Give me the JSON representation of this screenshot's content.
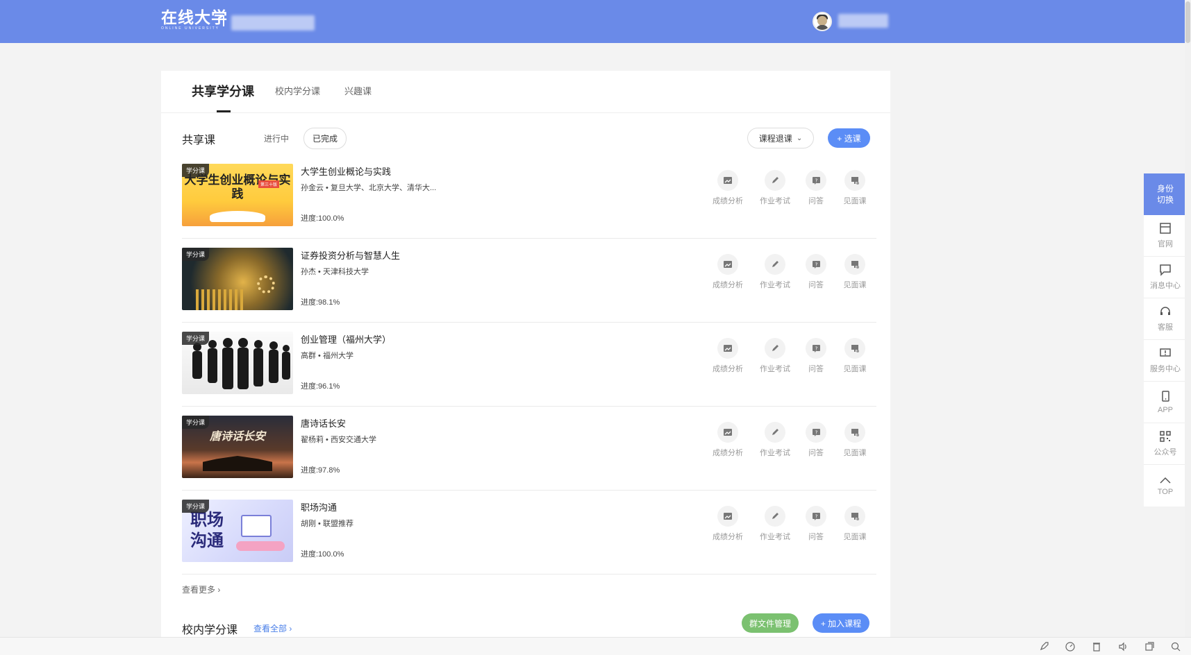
{
  "header": {
    "logo_text": "在线大学",
    "logo_sub": "ONLINE UNIVERSITY"
  },
  "tabs": [
    {
      "label": "共享学分课",
      "active": true
    },
    {
      "label": "校内学分课",
      "active": false
    },
    {
      "label": "兴趣课",
      "active": false
    }
  ],
  "shared": {
    "title": "共享课",
    "filter_ongoing": "进行中",
    "filter_done": "已完成",
    "dropdown_label": "课程退课",
    "select_button": "+ 选课",
    "badge": "学分课",
    "courses": [
      {
        "title": "大学生创业概论与实践",
        "teacher": "孙金云 • 复旦大学、北京大学、清华大...",
        "progress": "进度:100.0%",
        "thumb_text": "大学生创业概论与实践",
        "thumb_tag": "第三十版"
      },
      {
        "title": "证券投资分析与智慧人生",
        "teacher": "孙杰 • 天津科技大学",
        "progress": "进度:98.1%"
      },
      {
        "title": "创业管理（福州大学）",
        "teacher": "高群 • 福州大学",
        "progress": "进度:96.1%"
      },
      {
        "title": "唐诗话长安",
        "teacher": "翟杨莉 • 西安交通大学",
        "progress": "进度:97.8%",
        "thumb_text": "唐诗话长安"
      },
      {
        "title": "职场沟通",
        "teacher": "胡刚 • 联盟推荐",
        "progress": "进度:100.0%",
        "thumb_text": "职场沟通"
      }
    ],
    "actions": [
      "成绩分析",
      "作业考试",
      "问答",
      "见面课"
    ],
    "view_more": "查看更多"
  },
  "campus": {
    "title": "校内学分课",
    "view_all": "查看全部",
    "group_files_button": "群文件管理",
    "join_course_button": "+ 加入课程"
  },
  "sidebar": {
    "switch_label_1": "身份",
    "switch_label_2": "切换",
    "items": [
      {
        "label": "官网",
        "icon": "website-icon"
      },
      {
        "label": "消息中心",
        "icon": "message-icon"
      },
      {
        "label": "客服",
        "icon": "headset-icon"
      },
      {
        "label": "服务中心",
        "icon": "service-icon"
      },
      {
        "label": "APP",
        "icon": "phone-icon"
      },
      {
        "label": "公众号",
        "icon": "qrcode-icon"
      },
      {
        "label": "TOP",
        "icon": "up-arrow-icon"
      }
    ]
  },
  "colors": {
    "header": "#6a8ae8",
    "primary_button": "#5b8df6",
    "green_button": "#7bc170",
    "link": "#4a7fe8"
  }
}
